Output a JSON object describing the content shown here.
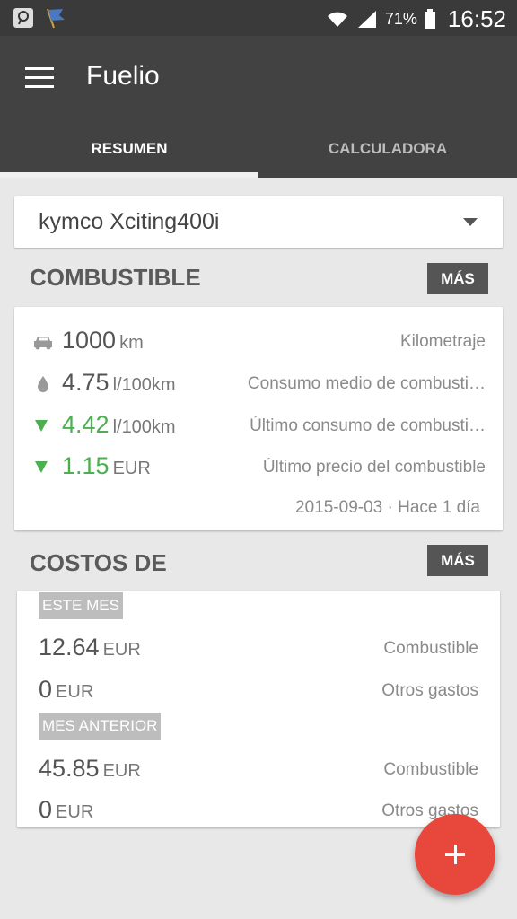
{
  "status_bar": {
    "battery": "71%",
    "time": "16:52"
  },
  "app": {
    "title": "Fuelio"
  },
  "tabs": [
    {
      "label": "RESUMEN"
    },
    {
      "label": "CALCULADORA"
    }
  ],
  "vehicle": {
    "selected": "kymco Xciting400i"
  },
  "fuel_section": {
    "title": "COMBUSTIBLE",
    "more_label": "MÁS",
    "rows": [
      {
        "icon": "car-icon",
        "value": "1000",
        "unit": "km",
        "label": "Kilometraje"
      },
      {
        "icon": "drop-icon",
        "value": "4.75",
        "unit": "l/100km",
        "label": "Consumo medio de combusti…"
      },
      {
        "icon": "trend-down-icon",
        "value": "4.42",
        "unit": "l/100km",
        "label": "Último consumo de combusti…"
      },
      {
        "icon": "trend-down-icon",
        "value": "1.15",
        "unit": "EUR",
        "label": "Último precio del combustible"
      }
    ],
    "date": "2015-09-03 · Hace 1 día"
  },
  "costs_section": {
    "title": "COSTOS DE",
    "more_label": "MÁS",
    "periods": [
      {
        "label": "ESTE MES",
        "rows": [
          {
            "value": "12.64",
            "unit": "EUR",
            "label": "Combustible"
          },
          {
            "value": "0",
            "unit": "EUR",
            "label": "Otros gastos"
          }
        ]
      },
      {
        "label": "MES ANTERIOR",
        "rows": [
          {
            "value": "45.85",
            "unit": "EUR",
            "label": "Combustible"
          },
          {
            "value": "0",
            "unit": "EUR",
            "label": "Otros gastos"
          }
        ]
      }
    ]
  },
  "colors": {
    "accent": "#e8483c",
    "positive": "#4caf50",
    "toolbar": "#424242"
  }
}
